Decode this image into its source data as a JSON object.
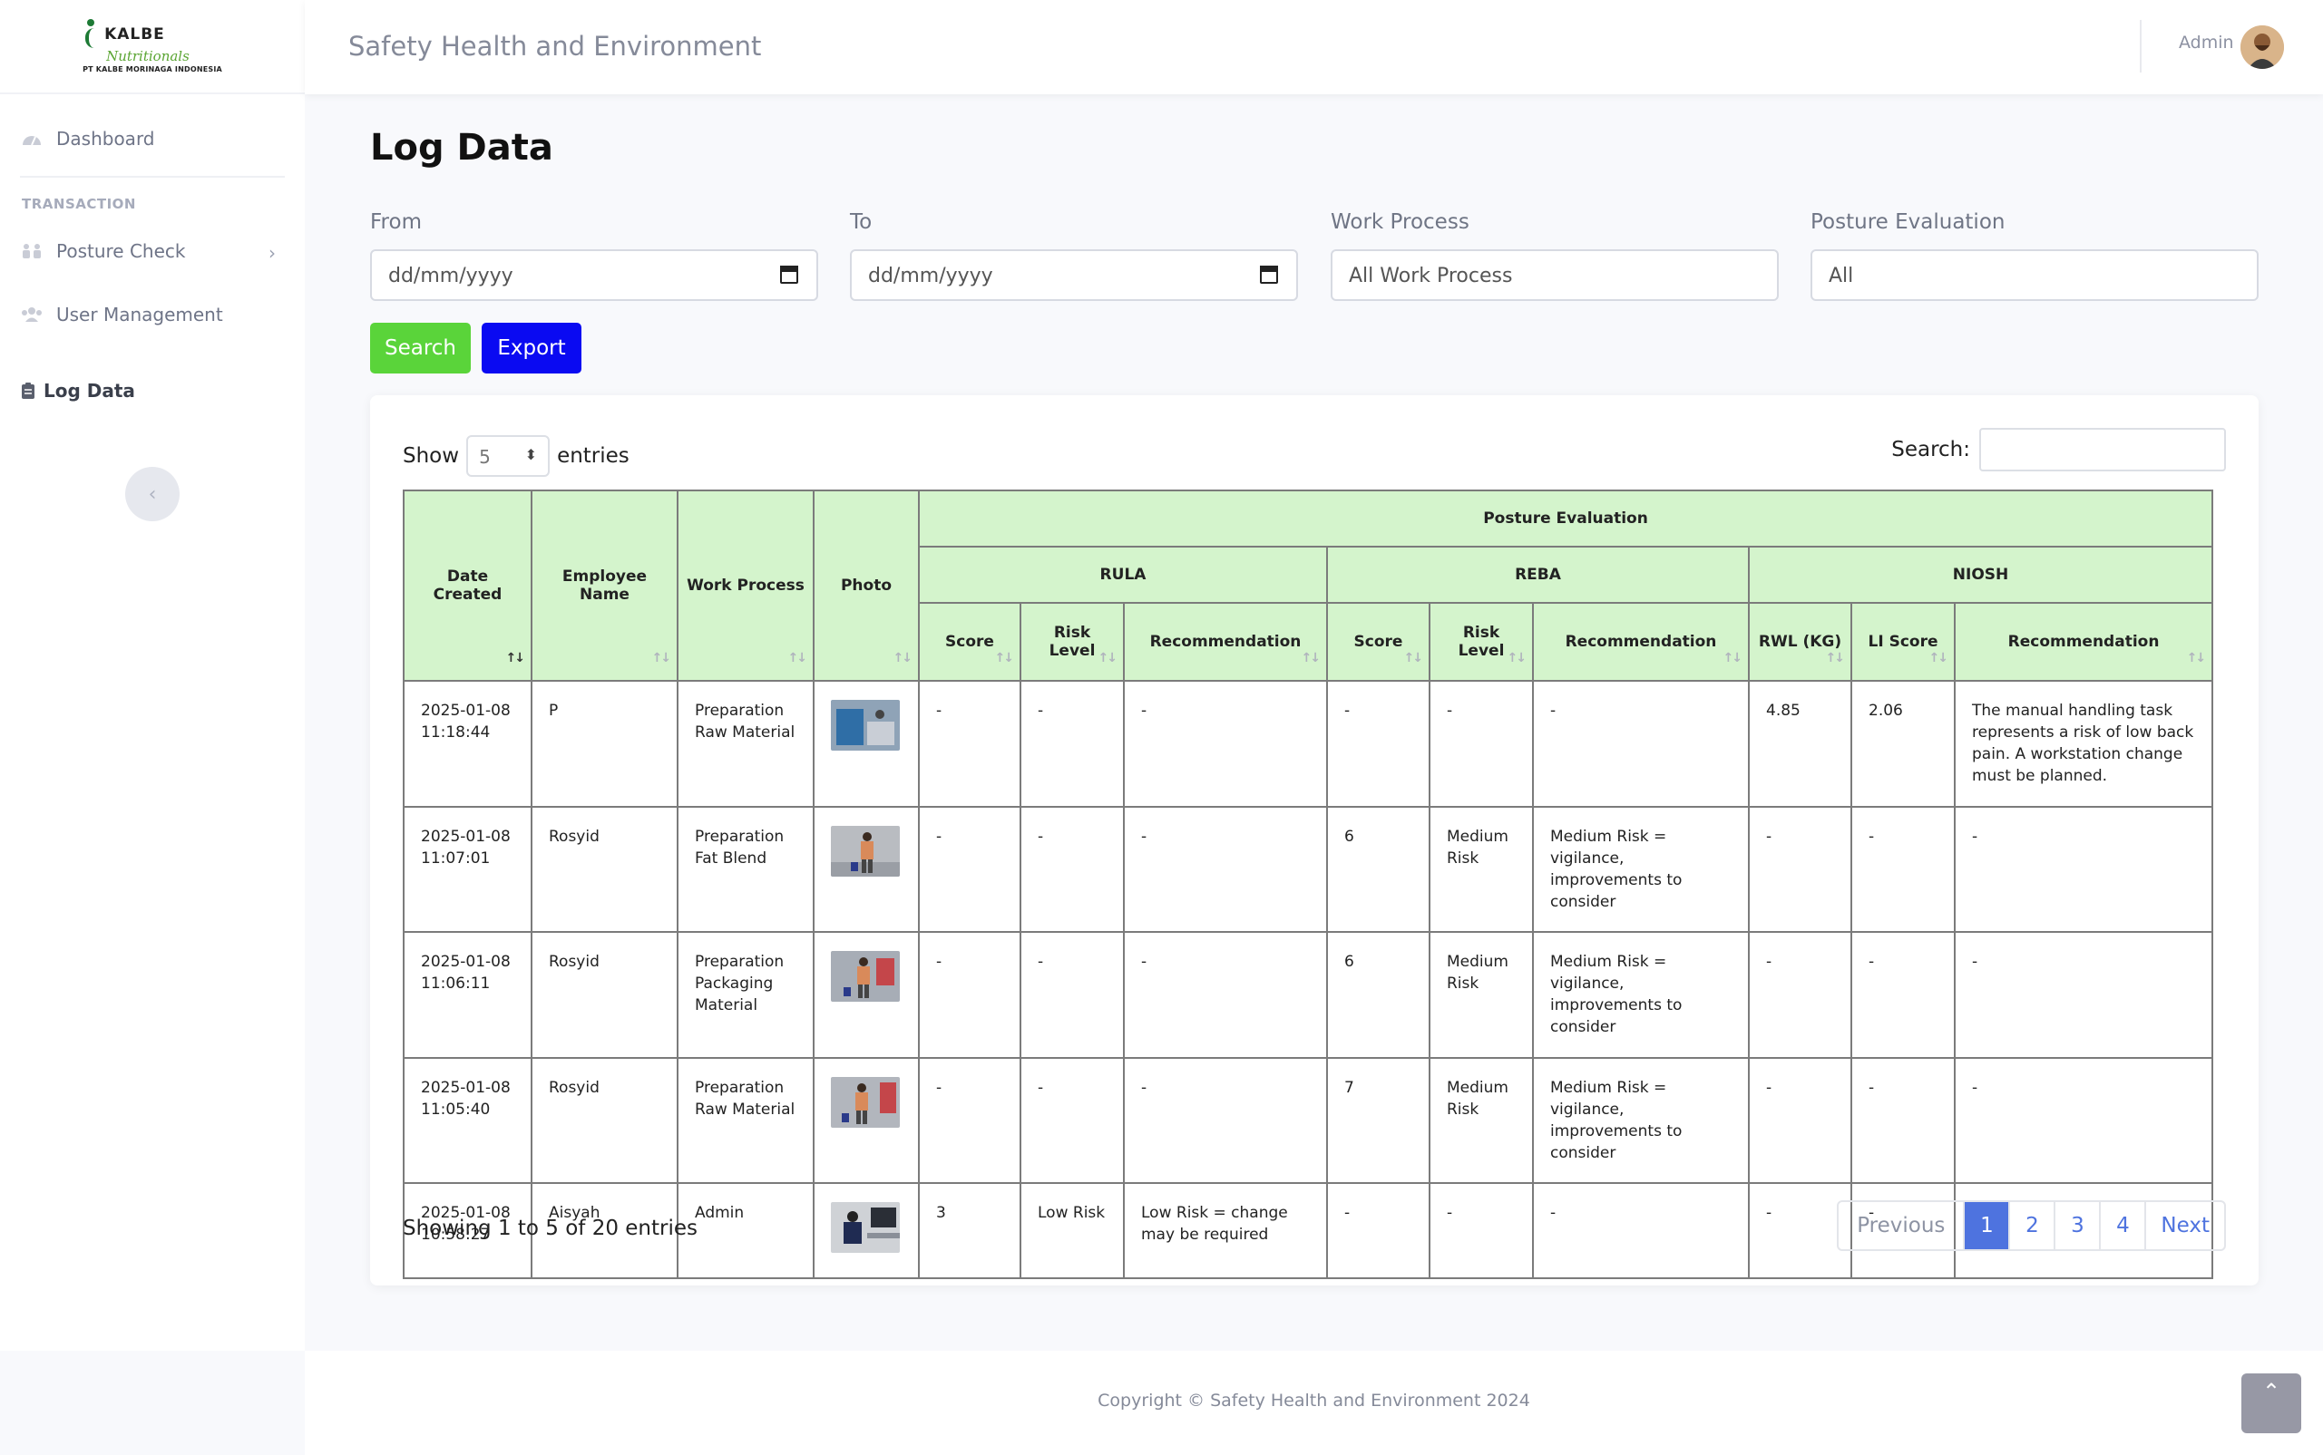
{
  "brand": {
    "name": "KALBE",
    "sub": "Nutritionals",
    "company": "PT KALBE MORINAGA INDONESIA"
  },
  "sidebar": {
    "dashboard": "Dashboard",
    "heading": "TRANSACTION",
    "posture_check": "Posture Check",
    "user_management": "User Management",
    "log_data": "Log Data"
  },
  "topbar": {
    "title": "Safety Health and Environment",
    "user": "Admin"
  },
  "page": {
    "title": "Log Data"
  },
  "filters": {
    "from_label": "From",
    "from_placeholder": "dd/mm/yyyy",
    "to_label": "To",
    "to_placeholder": "dd/mm/yyyy",
    "work_process_label": "Work Process",
    "work_process_value": "All Work Process",
    "posture_label": "Posture Evaluation",
    "posture_value": "All",
    "search_btn": "Search",
    "export_btn": "Export"
  },
  "table_controls": {
    "show": "Show",
    "entries_value": "5",
    "entries": "entries",
    "search_label": "Search:"
  },
  "table": {
    "headers": {
      "date": "Date Created",
      "employee": "Employee Name",
      "process": "Work Process",
      "photo": "Photo",
      "posture": "Posture Evaluation",
      "rula": "RULA",
      "reba": "REBA",
      "niosh": "NIOSH",
      "score": "Score",
      "risk_level": "Risk Level",
      "recommendation": "Recommendation",
      "rwl": "RWL (KG)",
      "li_score": "LI Score"
    },
    "rows": [
      {
        "date": "2025-01-08 11:18:44",
        "employee": "P",
        "process": "Preparation Raw Material",
        "rula_score": "-",
        "rula_risk": "-",
        "rula_rec": "-",
        "reba_score": "-",
        "reba_risk": "-",
        "reba_rec": "-",
        "rwl": "4.85",
        "li": "2.06",
        "niosh_rec": "The manual handling task represents a risk of low back pain. A workstation change must be planned."
      },
      {
        "date": "2025-01-08 11:07:01",
        "employee": "Rosyid",
        "process": "Preparation Fat Blend",
        "rula_score": "-",
        "rula_risk": "-",
        "rula_rec": "-",
        "reba_score": "6",
        "reba_risk": "Medium Risk",
        "reba_rec": "Medium Risk = vigilance, improvements to consider",
        "rwl": "-",
        "li": "-",
        "niosh_rec": "-"
      },
      {
        "date": "2025-01-08 11:06:11",
        "employee": "Rosyid",
        "process": "Preparation Packaging Material",
        "rula_score": "-",
        "rula_risk": "-",
        "rula_rec": "-",
        "reba_score": "6",
        "reba_risk": "Medium Risk",
        "reba_rec": "Medium Risk = vigilance, improvements to consider",
        "rwl": "-",
        "li": "-",
        "niosh_rec": "-"
      },
      {
        "date": "2025-01-08 11:05:40",
        "employee": "Rosyid",
        "process": "Preparation Raw Material",
        "rula_score": "-",
        "rula_risk": "-",
        "rula_rec": "-",
        "reba_score": "7",
        "reba_risk": "Medium Risk",
        "reba_rec": "Medium Risk = vigilance, improvements to consider",
        "rwl": "-",
        "li": "-",
        "niosh_rec": "-"
      },
      {
        "date": "2025-01-08 10:58:27",
        "employee": "Aisyah",
        "process": "Admin",
        "rula_score": "3",
        "rula_risk": "Low Risk",
        "rula_rec": "Low Risk = change may be required",
        "reba_score": "-",
        "reba_risk": "-",
        "reba_rec": "-",
        "rwl": "-",
        "li": "-",
        "niosh_rec": "-"
      }
    ]
  },
  "pagination": {
    "info": "Showing 1 to 5 of 20 entries",
    "previous": "Previous",
    "p1": "1",
    "p2": "2",
    "p3": "3",
    "p4": "4",
    "next": "Next"
  },
  "footer": {
    "copyright": "Copyright © Safety Health and Environment 2024"
  },
  "colors": {
    "accent": "#4e73df",
    "search_btn": "#5ad43a",
    "export_btn": "#0a0af2",
    "header_bg": "#d4f4cc"
  }
}
